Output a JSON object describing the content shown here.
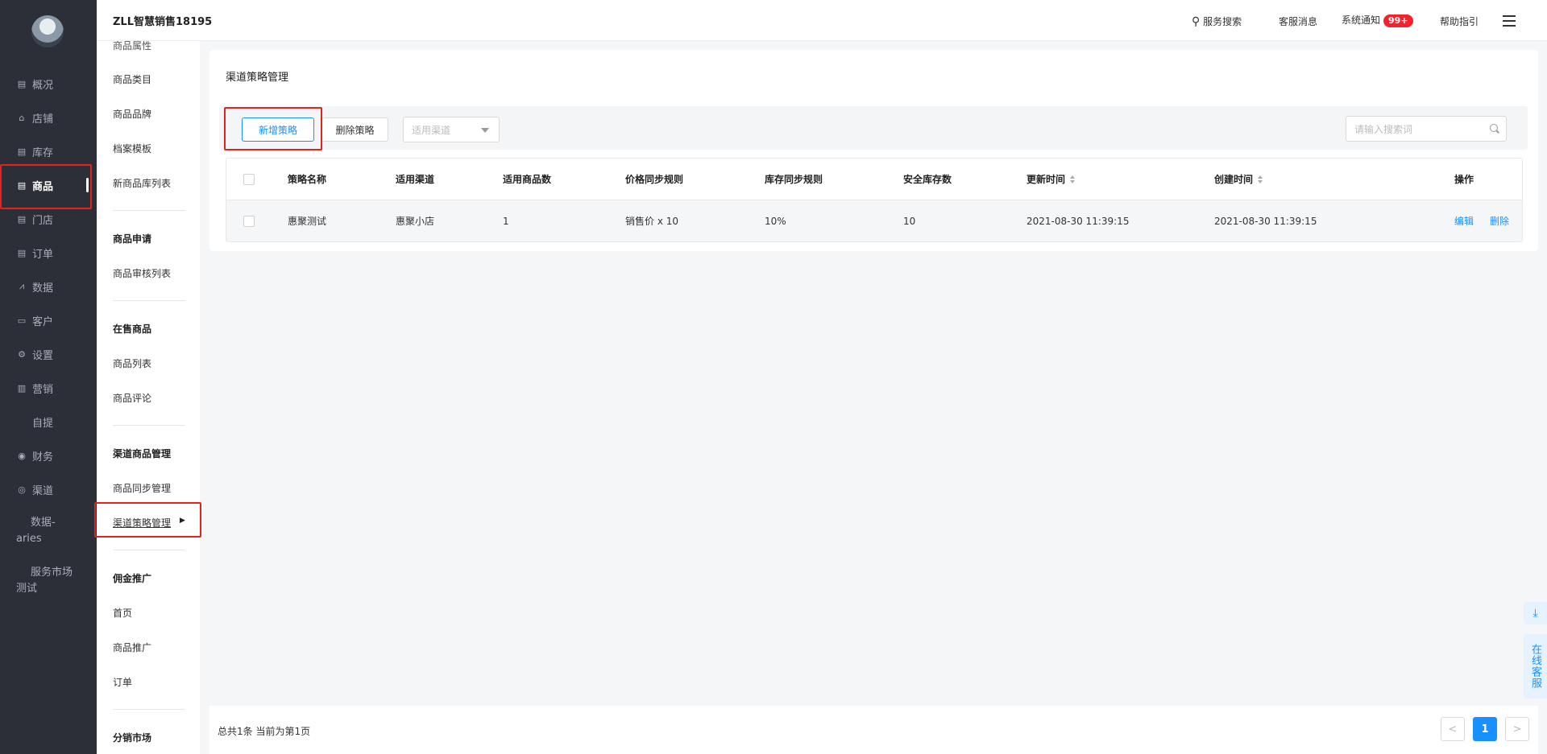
{
  "app": {
    "brand": "ZLL智慧销售18195"
  },
  "header": {
    "service_search": "服务搜索",
    "customer_message": "客服消息",
    "system_notice": "系统通知",
    "notice_badge": "99+",
    "help_guide": "帮助指引"
  },
  "rail": {
    "items": [
      {
        "label": "概况"
      },
      {
        "label": "店铺"
      },
      {
        "label": "库存"
      },
      {
        "label": "商品"
      },
      {
        "label": "门店"
      },
      {
        "label": "订单"
      },
      {
        "label": "数据"
      },
      {
        "label": "客户"
      },
      {
        "label": "设置"
      },
      {
        "label": "营销"
      },
      {
        "label": "自提"
      },
      {
        "label": "财务"
      },
      {
        "label": "渠道"
      },
      {
        "label": "数据-aries"
      },
      {
        "label": "服务市场测试"
      }
    ]
  },
  "subnav": {
    "top_cut": "商品属性",
    "items_a": [
      "商品类目",
      "商品品牌",
      "档案模板",
      "新商品库列表"
    ],
    "group_apply": "商品申请",
    "items_apply": [
      "商品审核列表"
    ],
    "group_onsale": "在售商品",
    "items_onsale": [
      "商品列表",
      "商品评论"
    ],
    "group_channel": "渠道商品管理",
    "items_channel": [
      "商品同步管理",
      "渠道策略管理"
    ],
    "group_commission": "佣金推广",
    "items_commission": [
      "首页",
      "商品推广",
      "订单"
    ],
    "group_market": "分销市场"
  },
  "page": {
    "title": "渠道策略管理",
    "add_button": "新增策略",
    "delete_button": "删除策略",
    "channel_select_placeholder": "适用渠道",
    "search_placeholder": "请输入搜索词"
  },
  "table": {
    "headers": {
      "name": "策略名称",
      "channel": "适用渠道",
      "goods_count": "适用商品数",
      "price_rule": "价格同步规则",
      "stock_rule": "库存同步规则",
      "safe_stock": "安全库存数",
      "updated": "更新时间",
      "created": "创建时间",
      "ops": "操作"
    },
    "rows": [
      {
        "name": "惠聚测试",
        "channel": "惠聚小店",
        "goods_count": "1",
        "price_rule": "销售价 x 10",
        "stock_rule": "10%",
        "safe_stock": "10",
        "updated": "2021-08-30 11:39:15",
        "created": "2021-08-30 11:39:15",
        "edit": "编辑",
        "delete": "删除"
      }
    ]
  },
  "pagination": {
    "summary": "总共1条 当前为第1页",
    "prev": "<",
    "current": "1",
    "next": ">"
  },
  "floating": {
    "download_icon": "⤓",
    "online_service": "在线客服"
  },
  "colors": {
    "primary": "#1890ff",
    "rail_bg": "#2c2f38",
    "highlight_box": "#e0241b",
    "badge": "#f5222d"
  }
}
